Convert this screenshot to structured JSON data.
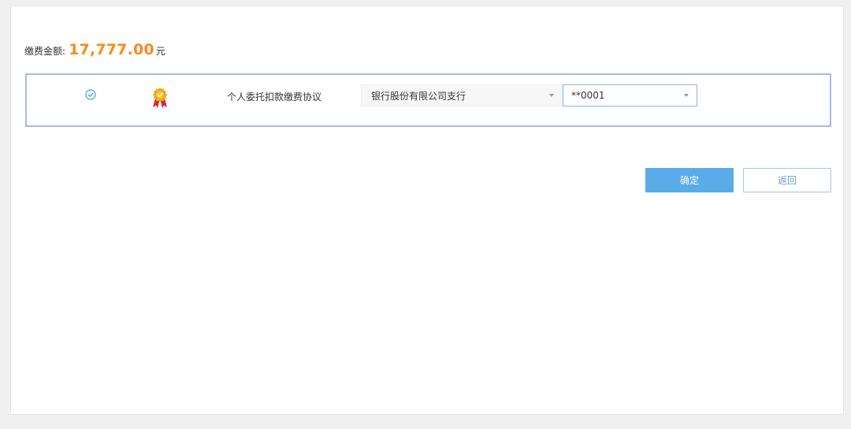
{
  "payment": {
    "amount_label": "缴费金额",
    "colon": ":",
    "amount_value": "17,777.00",
    "amount_unit": "元"
  },
  "agreement": {
    "selected": true,
    "name": "个人委托扣款缴费协议",
    "bank_select_value": "银行股份有限公司支行",
    "account_select_value": "**0001"
  },
  "actions": {
    "confirm_label": "确定",
    "back_label": "返回"
  },
  "colors": {
    "amount": "#fa8a1f",
    "primary_button": "#5aace8",
    "check": "#3b9fe0",
    "box_border": "#a9b9e3"
  },
  "icons": {
    "check": "check-circle-icon",
    "medal": "medal-badge-icon",
    "caret": "caret-down-icon"
  }
}
